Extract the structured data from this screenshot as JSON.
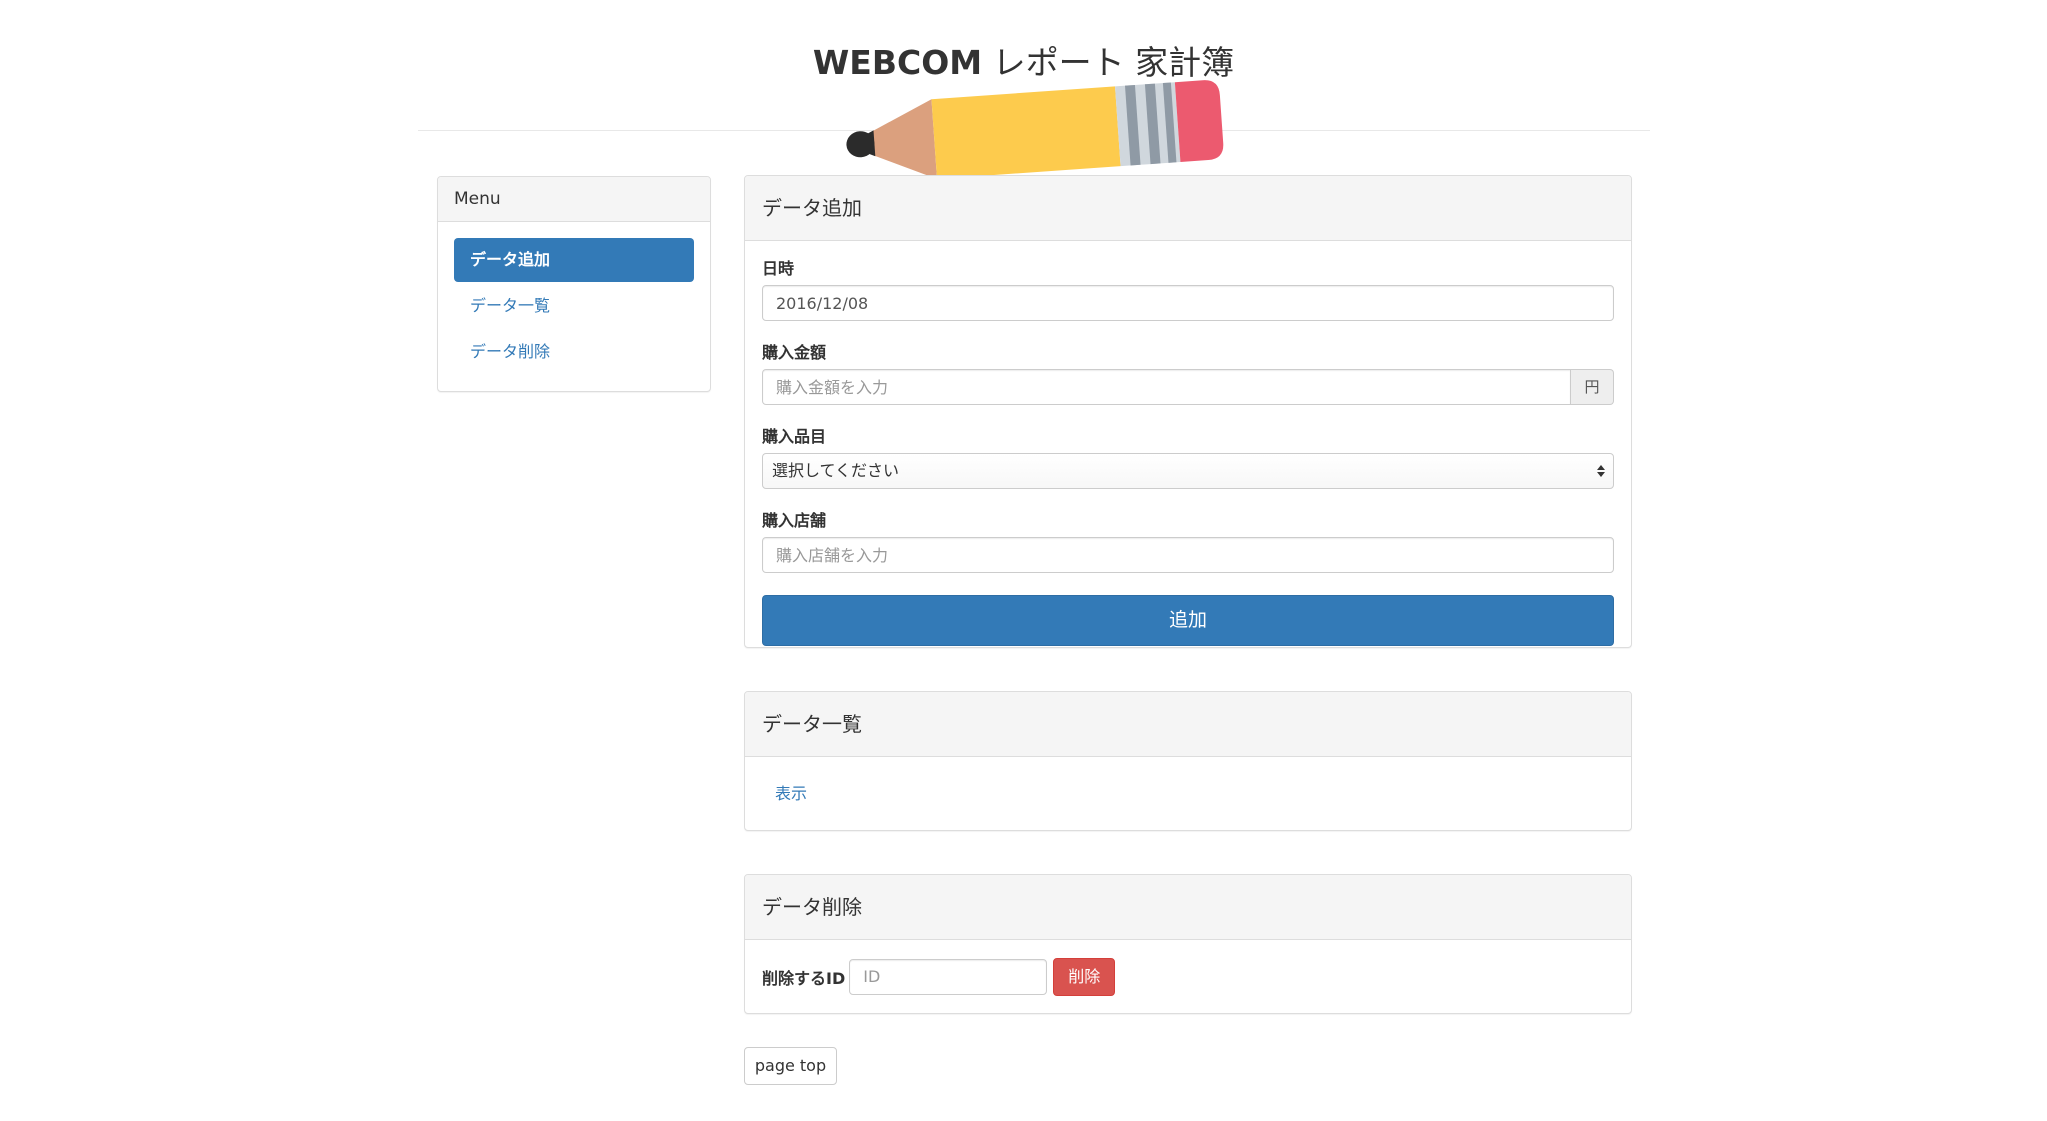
{
  "header": {
    "title_bold": "WEBCOM",
    "title_rest": " レポート 家計簿"
  },
  "sidebar": {
    "heading": "Menu",
    "items": [
      {
        "label": "データ追加",
        "active": true
      },
      {
        "label": "データ一覧",
        "active": false
      },
      {
        "label": "データ削除",
        "active": false
      }
    ]
  },
  "add_panel": {
    "heading": "データ追加",
    "date_label": "日時",
    "date_value": "2016/12/08",
    "amount_label": "購入金額",
    "amount_placeholder": "購入金額を入力",
    "amount_unit": "円",
    "item_label": "購入品目",
    "item_selected": "選択してください",
    "store_label": "購入店舗",
    "store_placeholder": "購入店舗を入力",
    "submit_label": "追加"
  },
  "list_panel": {
    "heading": "データ一覧",
    "show_link": "表示"
  },
  "delete_panel": {
    "heading": "データ削除",
    "id_label": "削除するID",
    "id_placeholder": "ID",
    "delete_label": "削除"
  },
  "footer": {
    "page_top_label": "page top"
  },
  "colors": {
    "primary": "#337ab7",
    "danger": "#d9534f",
    "panel_heading_bg": "#f5f5f5",
    "pencil_body": "#fdcb4d",
    "pencil_wood": "#dba07e",
    "pencil_eraser": "#ec5a6f"
  }
}
